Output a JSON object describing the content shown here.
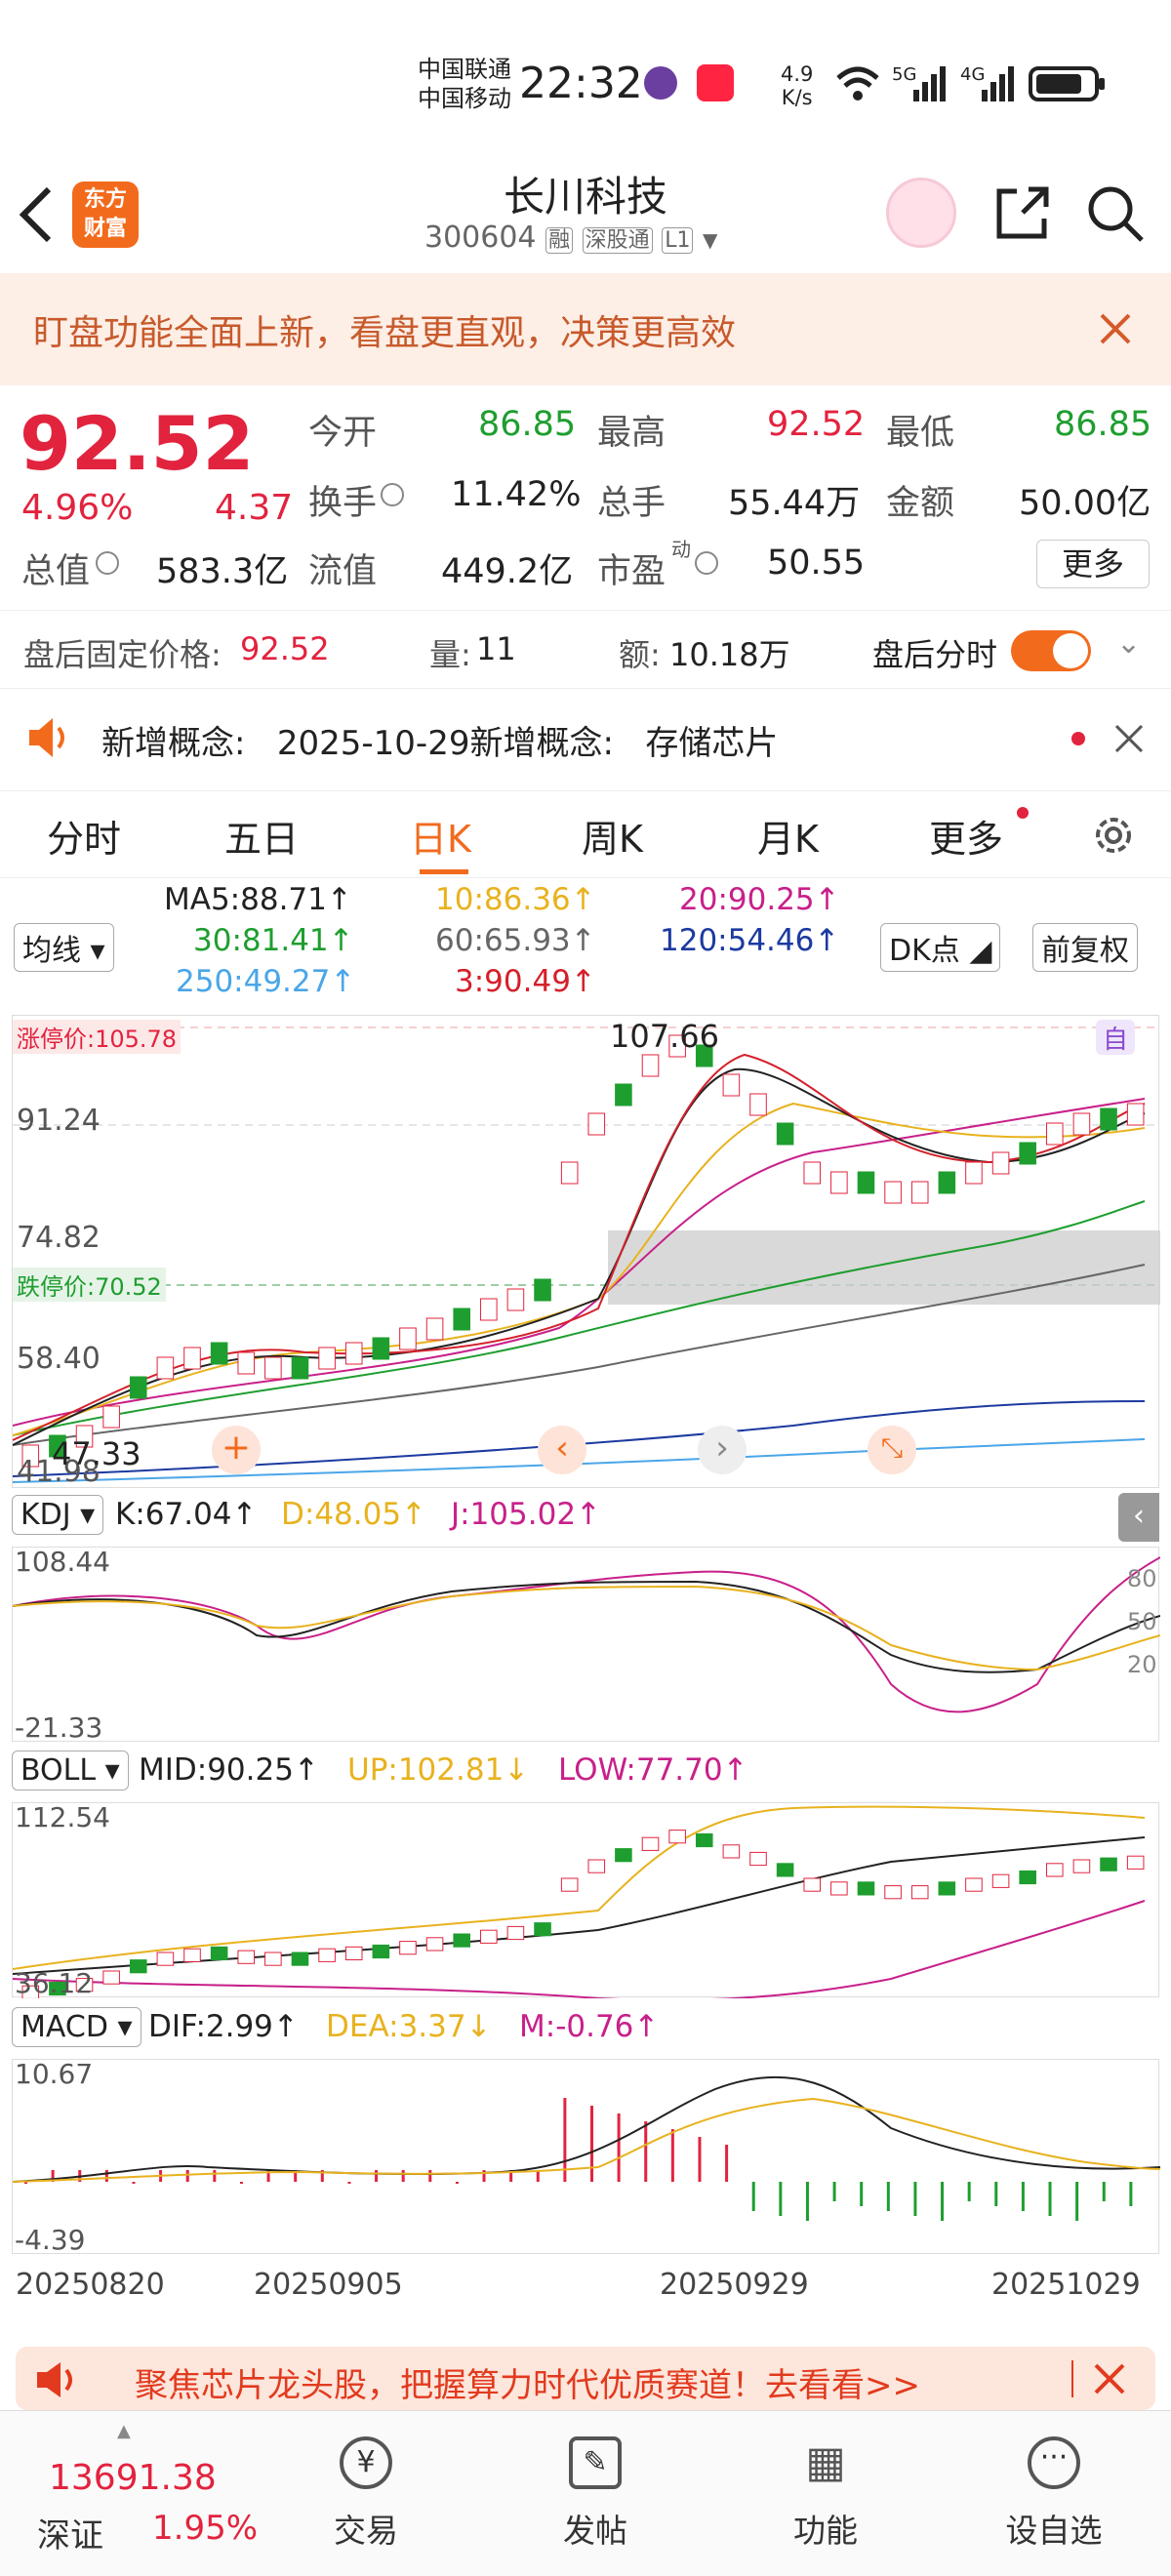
{
  "status_bar": {
    "carrier1": "中国联通",
    "carrier2": "中国移动",
    "time": "22:32",
    "speed_value": "4.9",
    "speed_unit": "K/s",
    "net1": "5G",
    "net2": "4G"
  },
  "header": {
    "title": "长川科技",
    "code": "300604",
    "tags": [
      "融",
      "深股通",
      "L1"
    ],
    "logo_line1": "东方",
    "logo_line2": "财富"
  },
  "banner": {
    "text": "盯盘功能全面上新，看盘更直观，决策更高效"
  },
  "quote": {
    "price": "92.52",
    "pct": "4.96%",
    "change": "4.37",
    "open_label": "今开",
    "open": "86.85",
    "high_label": "最高",
    "high": "92.52",
    "low_label": "最低",
    "low": "86.85",
    "turnover_label": "换手",
    "turnover": "11.42%",
    "volume_label": "总手",
    "volume": "55.44万",
    "amount_label": "金额",
    "amount": "50.00亿",
    "mcap_label": "总值",
    "mcap": "583.3亿",
    "float_label": "流值",
    "float": "449.2亿",
    "pe_label": "市盈",
    "pe_sup": "动",
    "pe": "50.55",
    "more": "更多"
  },
  "after_hours": {
    "price_label": "盘后固定价格:",
    "price": "92.52",
    "vol_label": "量:",
    "vol": "11",
    "amt_label": "额:",
    "amt": "10.18万",
    "toggle_label": "盘后分时"
  },
  "notice": {
    "text": "新增概念:   2025-10-29新增概念:   存储芯片"
  },
  "tabs": [
    "分时",
    "五日",
    "日K",
    "周K",
    "月K",
    "更多"
  ],
  "active_tab": "日K",
  "ma_panel": {
    "selector": "均线",
    "dk": "DK点",
    "fq": "前复权",
    "items": [
      {
        "text": "MA5:88.71↑",
        "color": "#222222"
      },
      {
        "text": "10:86.36↑",
        "color": "#e8b21e"
      },
      {
        "text": "20:90.25↑",
        "color": "#c8208a"
      },
      {
        "text": "30:81.41↑",
        "color": "#1e9e2f"
      },
      {
        "text": "60:65.93↑",
        "color": "#666666"
      },
      {
        "text": "120:54.46↑",
        "color": "#1c3aa0"
      },
      {
        "text": "250:49.27↑",
        "color": "#4aa6e8"
      },
      {
        "text": "3:90.49↑",
        "color": "#d4202b"
      }
    ]
  },
  "kline": {
    "limit_up": "涨停价:105.78",
    "limit_down": "跌停价:70.52",
    "y_labels": [
      "91.24",
      "74.82",
      "58.40",
      "41.98"
    ],
    "max_label": "107.66",
    "min_label": "47.33",
    "auto": "自"
  },
  "kdj": {
    "selector": "KDJ",
    "k": "K:67.04↑",
    "d": "D:48.05↑",
    "j": "J:105.02↑",
    "ymax": "108.44",
    "ymin": "-21.33",
    "levels": [
      "80",
      "50",
      "20"
    ]
  },
  "boll": {
    "selector": "BOLL",
    "mid": "MID:90.25↑",
    "up": "UP:102.81↓",
    "low": "LOW:77.70↑",
    "ymax": "112.54",
    "ymin": "36.12"
  },
  "macd": {
    "selector": "MACD",
    "dif": "DIF:2.99↑",
    "dea": "DEA:3.37↓",
    "m": "M:-0.76↑",
    "ymax": "10.67",
    "ymin": "-4.39"
  },
  "dates": [
    "20250820",
    "20250905",
    "20250929",
    "20251029"
  ],
  "ad": {
    "text": "聚焦芯片龙头股，把握算力时代优质赛道！去看看>>"
  },
  "bottom_nav": {
    "index_value": "13691.38",
    "index_name": "深证",
    "index_pct": "1.95%",
    "items": [
      "交易",
      "发帖",
      "功能",
      "设自选"
    ]
  },
  "colors": {
    "up": "#e2233e",
    "down": "#1e9e2f",
    "ma5": "#222222",
    "ma10": "#e8b21e",
    "ma20": "#c8208a",
    "ma30": "#1e9e2f",
    "ma60": "#666666",
    "ma120": "#1c3aa0",
    "ma250": "#4aa6e8",
    "accent": "#f26b1d"
  }
}
